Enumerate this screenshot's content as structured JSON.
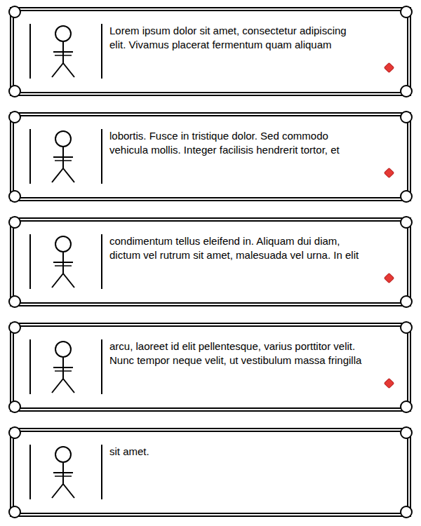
{
  "cards": [
    {
      "lines": [
        "Lorem ipsum dolor sit amet, consectetur adipiscing",
        "elit. Vivamus placerat fermentum quam aliquam"
      ],
      "marker": true
    },
    {
      "lines": [
        "lobortis. Fusce in tristique dolor. Sed commodo",
        "vehicula mollis. Integer facilisis hendrerit tortor, et"
      ],
      "marker": true
    },
    {
      "lines": [
        "condimentum tellus eleifend in. Aliquam dui diam,",
        "dictum vel rutrum sit amet, malesuada vel urna. In elit"
      ],
      "marker": true
    },
    {
      "lines": [
        "arcu, laoreet id elit pellentesque, varius porttitor velit.",
        "Nunc tempor neque velit, ut vestibulum massa fringilla"
      ],
      "marker": true
    },
    {
      "lines": [
        "sit amet."
      ],
      "marker": false
    }
  ]
}
